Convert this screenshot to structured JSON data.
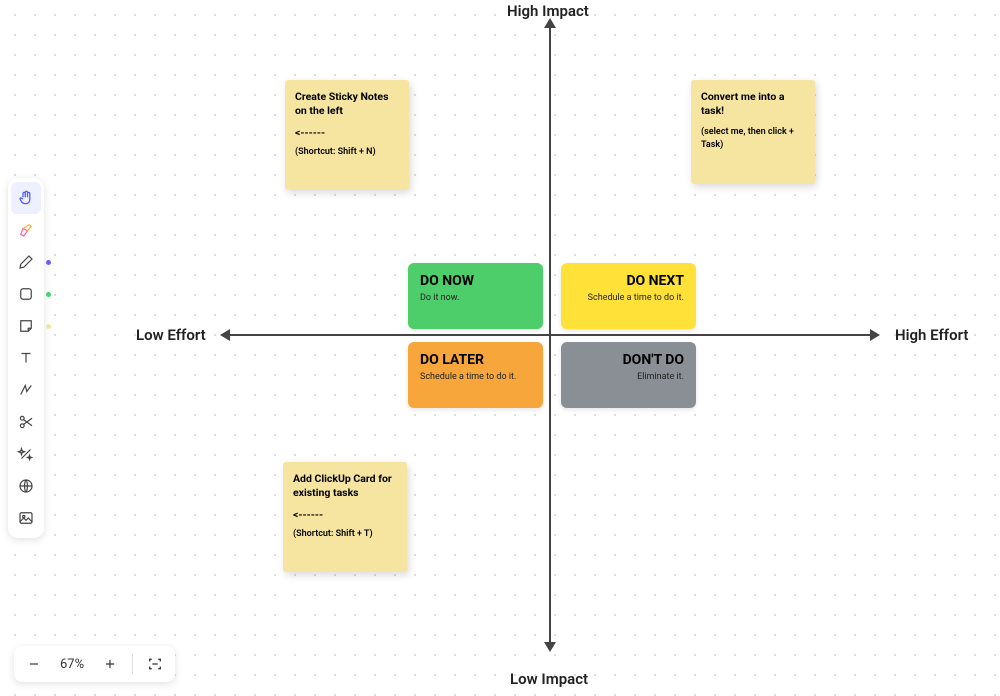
{
  "axes": {
    "top": "High Impact",
    "bottom": "Low Impact",
    "left": "Low Effort",
    "right": "High Effort"
  },
  "quadrants": {
    "do_now": {
      "title": "DO NOW",
      "sub": "Do it now."
    },
    "do_next": {
      "title": "DO NEXT",
      "sub": "Schedule a time to do it."
    },
    "do_later": {
      "title": "DO LATER",
      "sub": "Schedule a time to do it."
    },
    "dont_do": {
      "title": "DON'T DO",
      "sub": "Eliminate it."
    }
  },
  "stickies": {
    "s1": {
      "title": "Create Sticky Notes on the left",
      "arrow": "<------",
      "sub": "(Shortcut: Shift + N)"
    },
    "s2": {
      "title": "Convert me into a task!",
      "sub": "(select me, then click + Task)"
    },
    "s3": {
      "title": "Add ClickUp Card for existing tasks",
      "arrow": "<------",
      "sub": "(Shortcut: Shift + T)"
    }
  },
  "zoom": {
    "level": "67%"
  },
  "tools": {
    "hand": "hand-tool",
    "highlighter": "highlighter-tool",
    "pen": "pen-tool",
    "shape": "shape-tool",
    "sticky": "sticky-note-tool",
    "text": "text-tool",
    "connector": "connector-tool",
    "scissors": "scissors-tool",
    "magic": "magic-tool",
    "web": "web-tool",
    "image": "image-tool"
  },
  "colors": {
    "pen_dot": "#6a5cff",
    "shape_dot": "#3ad66f",
    "sticky_dot": "#f5e5a0"
  }
}
